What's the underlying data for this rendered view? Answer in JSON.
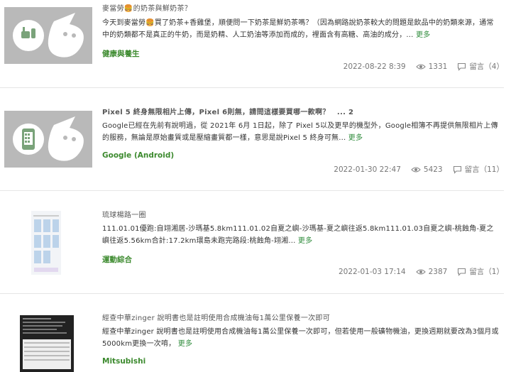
{
  "posts": [
    {
      "title": "麥當勞🍔的奶茶與鮮奶茶？",
      "summary": "今天到麥當勞🍔買了奶茶+香雞堡，順便問一下奶茶是鮮奶茶嗎？（因為網路說奶茶較大的問題是飲品中的奶類來源，通常中的奶類都不是真正的牛奶，而是奶精、人工奶油等添加而成的，裡面含有高糖、高油的成分，...",
      "more": "更多",
      "category": "健康與養生",
      "date": "2022-08-22 8:39",
      "views": "1331",
      "replies": "留言（4）",
      "thumb_icon": "health-icon"
    },
    {
      "title": "Pixel 5 終身無限相片上傳，Pixel 6則無，請問這樣要買哪一款啊？　... 2",
      "summary": "Google已經在先前有說明過，從 2021年 6月 1日起，除了 Pixel 5以及更早的機型外，Google相簿不再提供無限相片上傳的服務，無論是原始畫質或是壓縮畫質都一樣，意思是說Pixel 5 終身可無...",
      "more": "更多",
      "category": "Google (Android)",
      "date": "2022-01-30 22:47",
      "views": "5423",
      "replies": "留言（11）",
      "thumb_icon": "phone-icon"
    },
    {
      "title": "琉球楊路一圈",
      "summary": "111.01.01優跑:自翊湘居-沙瑪基5.8km111.01.02自夏之嶼-沙瑪基-夏之嶼往返5.8km111.01.03自夏之嶼-桃蝕角-夏之嶼往返5.56km合計:17.2km環島未跑完路段:桃蝕角-翊湘...",
      "more": "更多",
      "category": "運動綜合",
      "date": "2022-01-03 17:14",
      "views": "2387",
      "replies": "留言（1）"
    },
    {
      "title": "經查中華zinger 說明書也是註明使用合成機油每1萬公里保養一次即可",
      "summary": "經查中華zinger 說明書也是註明使用合成機油每1萬公里保養一次即可，但若使用一般礦物機油，更換週期就要改為3個月或5000km更換一次唷，",
      "more": "更多",
      "category": "Mitsubishi"
    }
  ],
  "colors": {
    "category": "#3c8a2e",
    "more": "#2e8b3b",
    "placeholder": "#b9b9b9"
  }
}
